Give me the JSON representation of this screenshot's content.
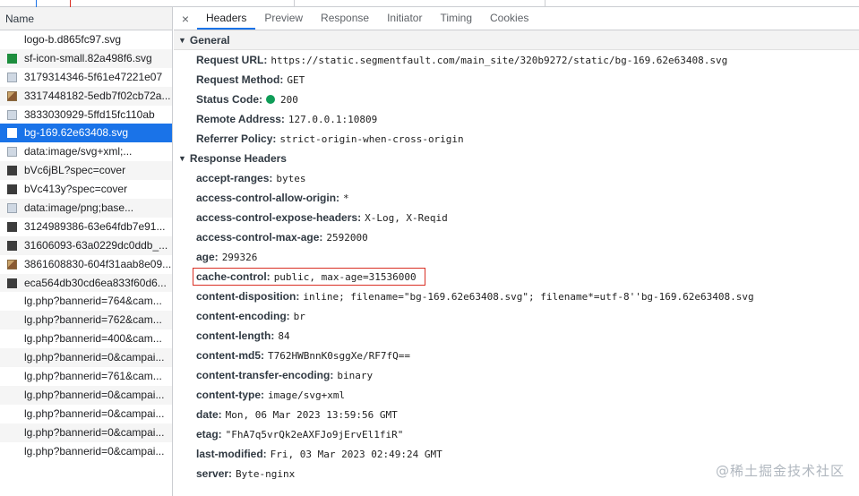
{
  "left_pane": {
    "header": "Name",
    "files": [
      {
        "name": "logo-b.d865fc97.svg",
        "icon": "svg-file-icon",
        "style": "blank"
      },
      {
        "name": "sf-icon-small.82a498f6.svg",
        "icon": "green-square-icon",
        "style": "green"
      },
      {
        "name": "3179314346-5f61e47221e07",
        "icon": "image-file-icon",
        "style": "imgbox"
      },
      {
        "name": "3317448182-5edb7f02cb72a...",
        "icon": "photo-thumbnail-icon",
        "style": "photo"
      },
      {
        "name": "3833030929-5ffd15fc110ab",
        "icon": "image-file-icon",
        "style": "imgbox"
      },
      {
        "name": "bg-169.62e63408.svg",
        "icon": "svg-file-icon",
        "style": "white",
        "selected": true
      },
      {
        "name": "data:image/svg+xml;...",
        "icon": "image-file-icon",
        "style": "imgbox"
      },
      {
        "name": "bVc6jBL?spec=cover",
        "icon": "dark-image-icon",
        "style": "dark"
      },
      {
        "name": "bVc413y?spec=cover",
        "icon": "dark-image-icon",
        "style": "dark"
      },
      {
        "name": "data:image/png;base...",
        "icon": "image-file-icon",
        "style": "imgbox"
      },
      {
        "name": "3124989386-63e64fdb7e91...",
        "icon": "dark-image-icon",
        "style": "dark"
      },
      {
        "name": "31606093-63a0229dc0ddb_...",
        "icon": "dark-image-icon",
        "style": "dark"
      },
      {
        "name": "3861608830-604f31aab8e09...",
        "icon": "photo-thumbnail-icon",
        "style": "photo"
      },
      {
        "name": "eca564db30cd6ea833f60d6...",
        "icon": "dark-image-icon",
        "style": "dark"
      },
      {
        "name": "lg.php?bannerid=764&cam...",
        "icon": "blank-icon",
        "style": "blank"
      },
      {
        "name": "lg.php?bannerid=762&cam...",
        "icon": "blank-icon",
        "style": "blank"
      },
      {
        "name": "lg.php?bannerid=400&cam...",
        "icon": "blank-icon",
        "style": "blank"
      },
      {
        "name": "lg.php?bannerid=0&campai...",
        "icon": "blank-icon",
        "style": "blank"
      },
      {
        "name": "lg.php?bannerid=761&cam...",
        "icon": "blank-icon",
        "style": "blank"
      },
      {
        "name": "lg.php?bannerid=0&campai...",
        "icon": "blank-icon",
        "style": "blank"
      },
      {
        "name": "lg.php?bannerid=0&campai...",
        "icon": "blank-icon",
        "style": "blank"
      },
      {
        "name": "lg.php?bannerid=0&campai...",
        "icon": "blank-icon",
        "style": "blank"
      },
      {
        "name": "lg.php?bannerid=0&campai...",
        "icon": "blank-icon",
        "style": "blank"
      }
    ]
  },
  "tabs": {
    "close_icon": "×",
    "items": [
      "Headers",
      "Preview",
      "Response",
      "Initiator",
      "Timing",
      "Cookies"
    ],
    "active": "Headers"
  },
  "general": {
    "title": "General",
    "request_url": {
      "label": "Request URL:",
      "value": "https://static.segmentfault.com/main_site/320b9272/static/bg-169.62e63408.svg"
    },
    "request_method": {
      "label": "Request Method:",
      "value": "GET"
    },
    "status_code": {
      "label": "Status Code:",
      "value": "200",
      "dot_color": "#0f9d58"
    },
    "remote_address": {
      "label": "Remote Address:",
      "value": "127.0.0.1:10809"
    },
    "referrer_policy": {
      "label": "Referrer Policy:",
      "value": "strict-origin-when-cross-origin"
    }
  },
  "response_headers": {
    "title": "Response Headers",
    "items": [
      {
        "key": "accept-ranges:",
        "value": "bytes"
      },
      {
        "key": "access-control-allow-origin:",
        "value": "*"
      },
      {
        "key": "access-control-expose-headers:",
        "value": "X-Log, X-Reqid"
      },
      {
        "key": "access-control-max-age:",
        "value": "2592000"
      },
      {
        "key": "age:",
        "value": "299326"
      },
      {
        "key": "cache-control:",
        "value": "public, max-age=31536000",
        "highlighted": true
      },
      {
        "key": "content-disposition:",
        "value": "inline; filename=\"bg-169.62e63408.svg\"; filename*=utf-8''bg-169.62e63408.svg"
      },
      {
        "key": "content-encoding:",
        "value": "br"
      },
      {
        "key": "content-length:",
        "value": "84"
      },
      {
        "key": "content-md5:",
        "value": "T762HWBnnK0sggXe/RF7fQ=="
      },
      {
        "key": "content-transfer-encoding:",
        "value": "binary"
      },
      {
        "key": "content-type:",
        "value": "image/svg+xml"
      },
      {
        "key": "date:",
        "value": "Mon, 06 Mar 2023 13:59:56 GMT"
      },
      {
        "key": "etag:",
        "value": "\"FhA7q5vrQk2eAXFJo9jErvEl1fiR\""
      },
      {
        "key": "last-modified:",
        "value": "Fri, 03 Mar 2023 02:49:24 GMT"
      },
      {
        "key": "server:",
        "value": "Byte-nginx"
      }
    ]
  },
  "watermark": "@稀土掘金技术社区",
  "colors": {
    "selected_row": "#1a73e8",
    "highlight_border": "#d93025",
    "status_ok": "#0f9d58"
  }
}
